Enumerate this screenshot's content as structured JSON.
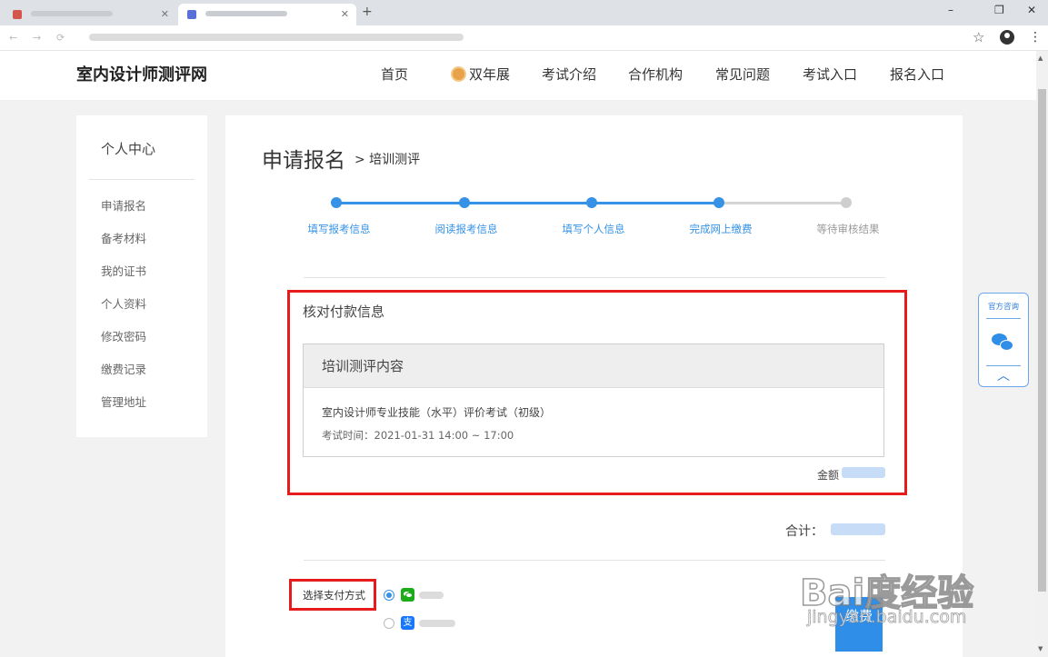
{
  "browser": {
    "tabs": [
      {
        "label": ""
      },
      {
        "label": ""
      }
    ],
    "new_tab": "+",
    "minimize": "–",
    "restore": "❐",
    "close": "✕",
    "back": "←",
    "forward": "→",
    "reload": "⟳",
    "star": "☆",
    "menu": "⋮"
  },
  "site": {
    "logo": "室内设计师测评网",
    "nav": [
      "首页",
      "双年展",
      "考试介绍",
      "合作机构",
      "常见问题",
      "考试入口",
      "报名入口"
    ]
  },
  "sidebar": {
    "title": "个人中心",
    "items": [
      "申请报名",
      "备考材料",
      "我的证书",
      "个人资料",
      "修改密码",
      "缴费记录",
      "管理地址"
    ]
  },
  "main": {
    "title": "申请报名",
    "subtitle": "> 培训测评",
    "steps": [
      {
        "label": "填写报考信息",
        "done": true
      },
      {
        "label": "阅读报考信息",
        "done": true
      },
      {
        "label": "填写个人信息",
        "done": true
      },
      {
        "label": "完成网上缴费",
        "done": true
      },
      {
        "label": "等待审核结果",
        "done": false
      }
    ],
    "payment_title": "核对付款信息",
    "course_header": "培训测评内容",
    "course_name": "室内设计师专业技能（水平）评价考试（初级）",
    "course_time": "考试时间：2021-01-31 14:00 ~ 17:00",
    "amount_label": "金额",
    "total_label": "合计：",
    "pay_method_label": "选择支付方式",
    "alipay_glyph": "支",
    "pay_button": "缴费"
  },
  "consult": {
    "label": "官方咨询",
    "up": "︿"
  },
  "colors": {
    "accent": "#3592e6",
    "highlight_red": "#e61c1c",
    "wechat_green": "#1aad19",
    "alipay_blue": "#1677ff"
  },
  "watermark": {
    "line1": "Bai度经验",
    "line2": "jingyan.baidu.com"
  }
}
